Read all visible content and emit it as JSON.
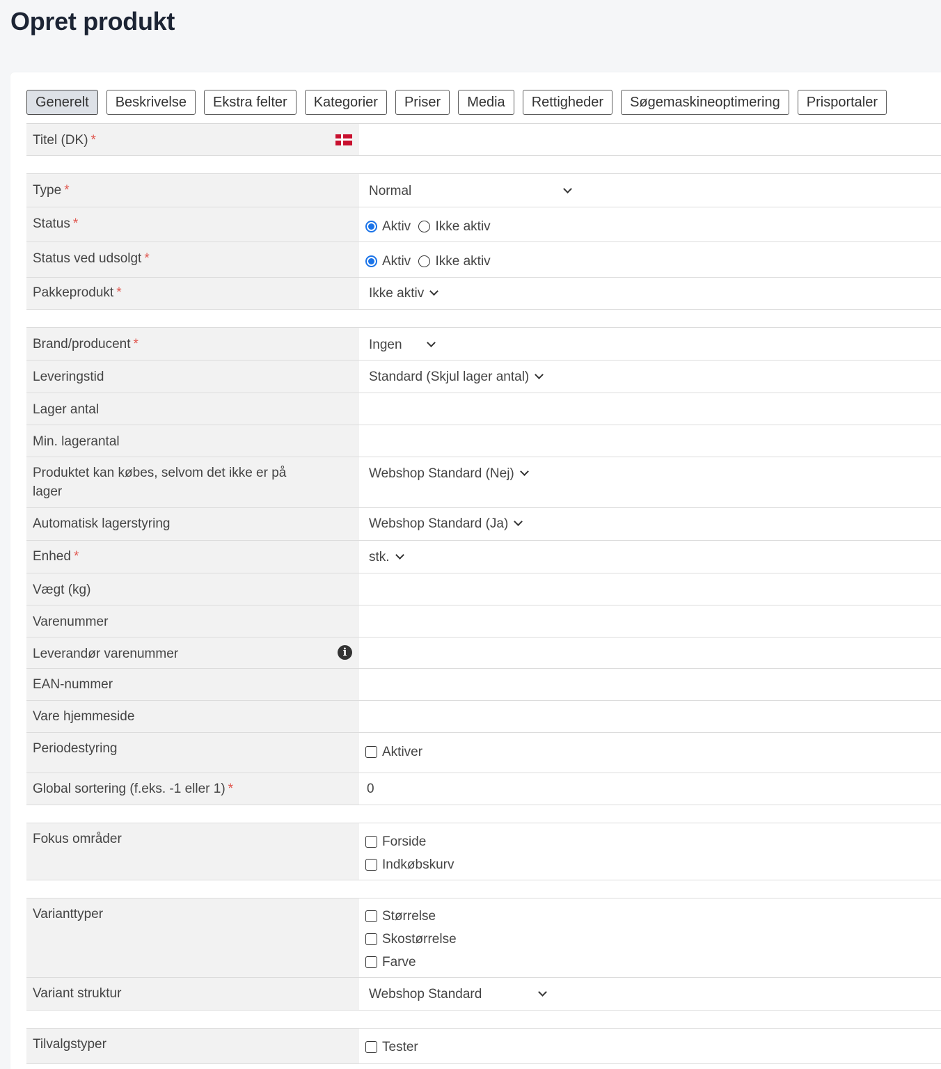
{
  "page": {
    "title": "Opret produkt"
  },
  "tabs": [
    {
      "label": "Generelt"
    },
    {
      "label": "Beskrivelse"
    },
    {
      "label": "Ekstra felter"
    },
    {
      "label": "Kategorier"
    },
    {
      "label": "Priser"
    },
    {
      "label": "Media"
    },
    {
      "label": "Rettigheder"
    },
    {
      "label": "Søgemaskineoptimering"
    },
    {
      "label": "Prisportaler"
    }
  ],
  "form": {
    "required_marker": "*",
    "title": {
      "label": "Titel (DK)",
      "value": "",
      "flag_icon": "danish-flag-icon"
    },
    "type": {
      "label": "Type",
      "value": "Normal"
    },
    "status": {
      "label": "Status",
      "opt1": "Aktiv",
      "opt2": "Ikke aktiv",
      "selected": "Aktiv"
    },
    "status_soldout": {
      "label": "Status ved udsolgt",
      "opt1": "Aktiv",
      "opt2": "Ikke aktiv",
      "selected": "Aktiv"
    },
    "package": {
      "label": "Pakkeprodukt",
      "value": "Ikke aktiv"
    },
    "brand": {
      "label": "Brand/producent",
      "value": "Ingen"
    },
    "delivery": {
      "label": "Leveringstid",
      "value": "Standard (Skjul lager antal)"
    },
    "stock": {
      "label": "Lager antal",
      "value": ""
    },
    "min_stock": {
      "label": "Min. lagerantal",
      "value": ""
    },
    "backorder": {
      "label": "Produktet kan købes, selvom det ikke er på lager",
      "value": "Webshop Standard (Nej)"
    },
    "auto_stock": {
      "label": "Automatisk lagerstyring",
      "value": "Webshop Standard (Ja)"
    },
    "unit": {
      "label": "Enhed",
      "value": "stk."
    },
    "weight": {
      "label": "Vægt (kg)",
      "value": ""
    },
    "sku": {
      "label": "Varenummer",
      "value": ""
    },
    "supplier_sku": {
      "label": "Leverandør varenummer",
      "value": "",
      "info_icon": "i"
    },
    "ean": {
      "label": "EAN-nummer",
      "value": ""
    },
    "homepage": {
      "label": "Vare hjemmeside",
      "value": ""
    },
    "period": {
      "label": "Periodestyring",
      "option": "Aktiver"
    },
    "sort": {
      "label": "Global sortering (f.eks. -1 eller 1)",
      "value": "0"
    },
    "focus": {
      "label": "Fokus områder",
      "options": [
        "Forside",
        "Indkøbskurv"
      ]
    },
    "variant_types": {
      "label": "Varianttyper",
      "options": [
        "Størrelse",
        "Skostørrelse",
        "Farve"
      ]
    },
    "variant_structure": {
      "label": "Variant struktur",
      "value": "Webshop Standard"
    },
    "addon_types": {
      "label": "Tilvalgstyper",
      "options": [
        "Tester"
      ]
    }
  }
}
